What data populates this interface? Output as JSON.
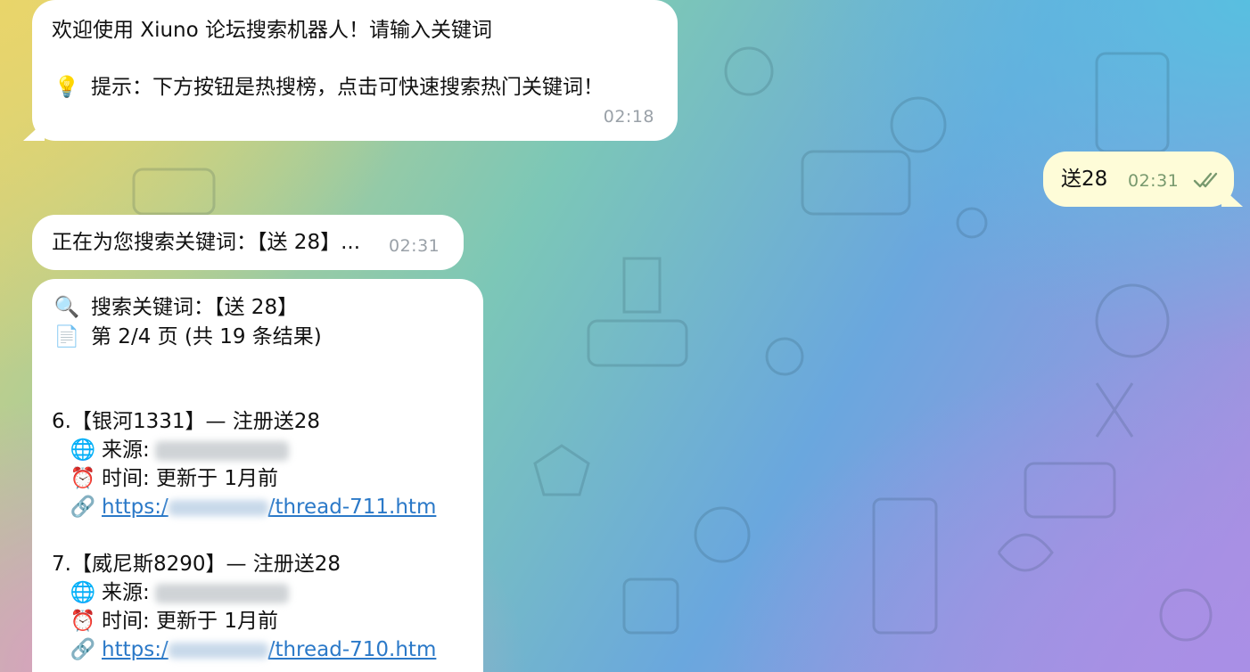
{
  "messages": {
    "welcome": {
      "line1": "欢迎使用 Xiuno 论坛搜索机器人！请输入关键词",
      "tip_icon": "💡",
      "line2": "提示：下方按钮是热搜榜，点击可快速搜索热门关键词！",
      "time": "02:18"
    },
    "user": {
      "text": "送28",
      "time": "02:31",
      "status_icon": "double-check-icon"
    },
    "searching": {
      "text": "正在为您搜索关键词：【送 28】...",
      "time": "02:31"
    },
    "results": {
      "search_icon": "🔍",
      "keyword_line": "搜索关键词：【送 28】",
      "page_icon": "📄",
      "page_line": "第 2/4 页 (共 19 条结果)",
      "items": [
        {
          "title": "6.【银河1331】— 注册送28",
          "source_icon": "🌐",
          "source_label": "来源:",
          "time_icon": "⏰",
          "time_text": "时间: 更新于 1月前",
          "link_icon": "🔗",
          "link_prefix": "https:/",
          "link_suffix": "/thread-711.htm"
        },
        {
          "title": "7.【威尼斯8290】— 注册送28",
          "source_icon": "🌐",
          "source_label": "来源:",
          "time_icon": "⏰",
          "time_text": "时间: 更新于 1月前",
          "link_icon": "🔗",
          "link_prefix": "https:/",
          "link_suffix": "/thread-710.htm"
        }
      ]
    }
  },
  "colors": {
    "bubble_in": "#ffffff",
    "bubble_out": "#fefcd8",
    "link": "#2b79c8",
    "timestamp": "#9aa1a8"
  }
}
